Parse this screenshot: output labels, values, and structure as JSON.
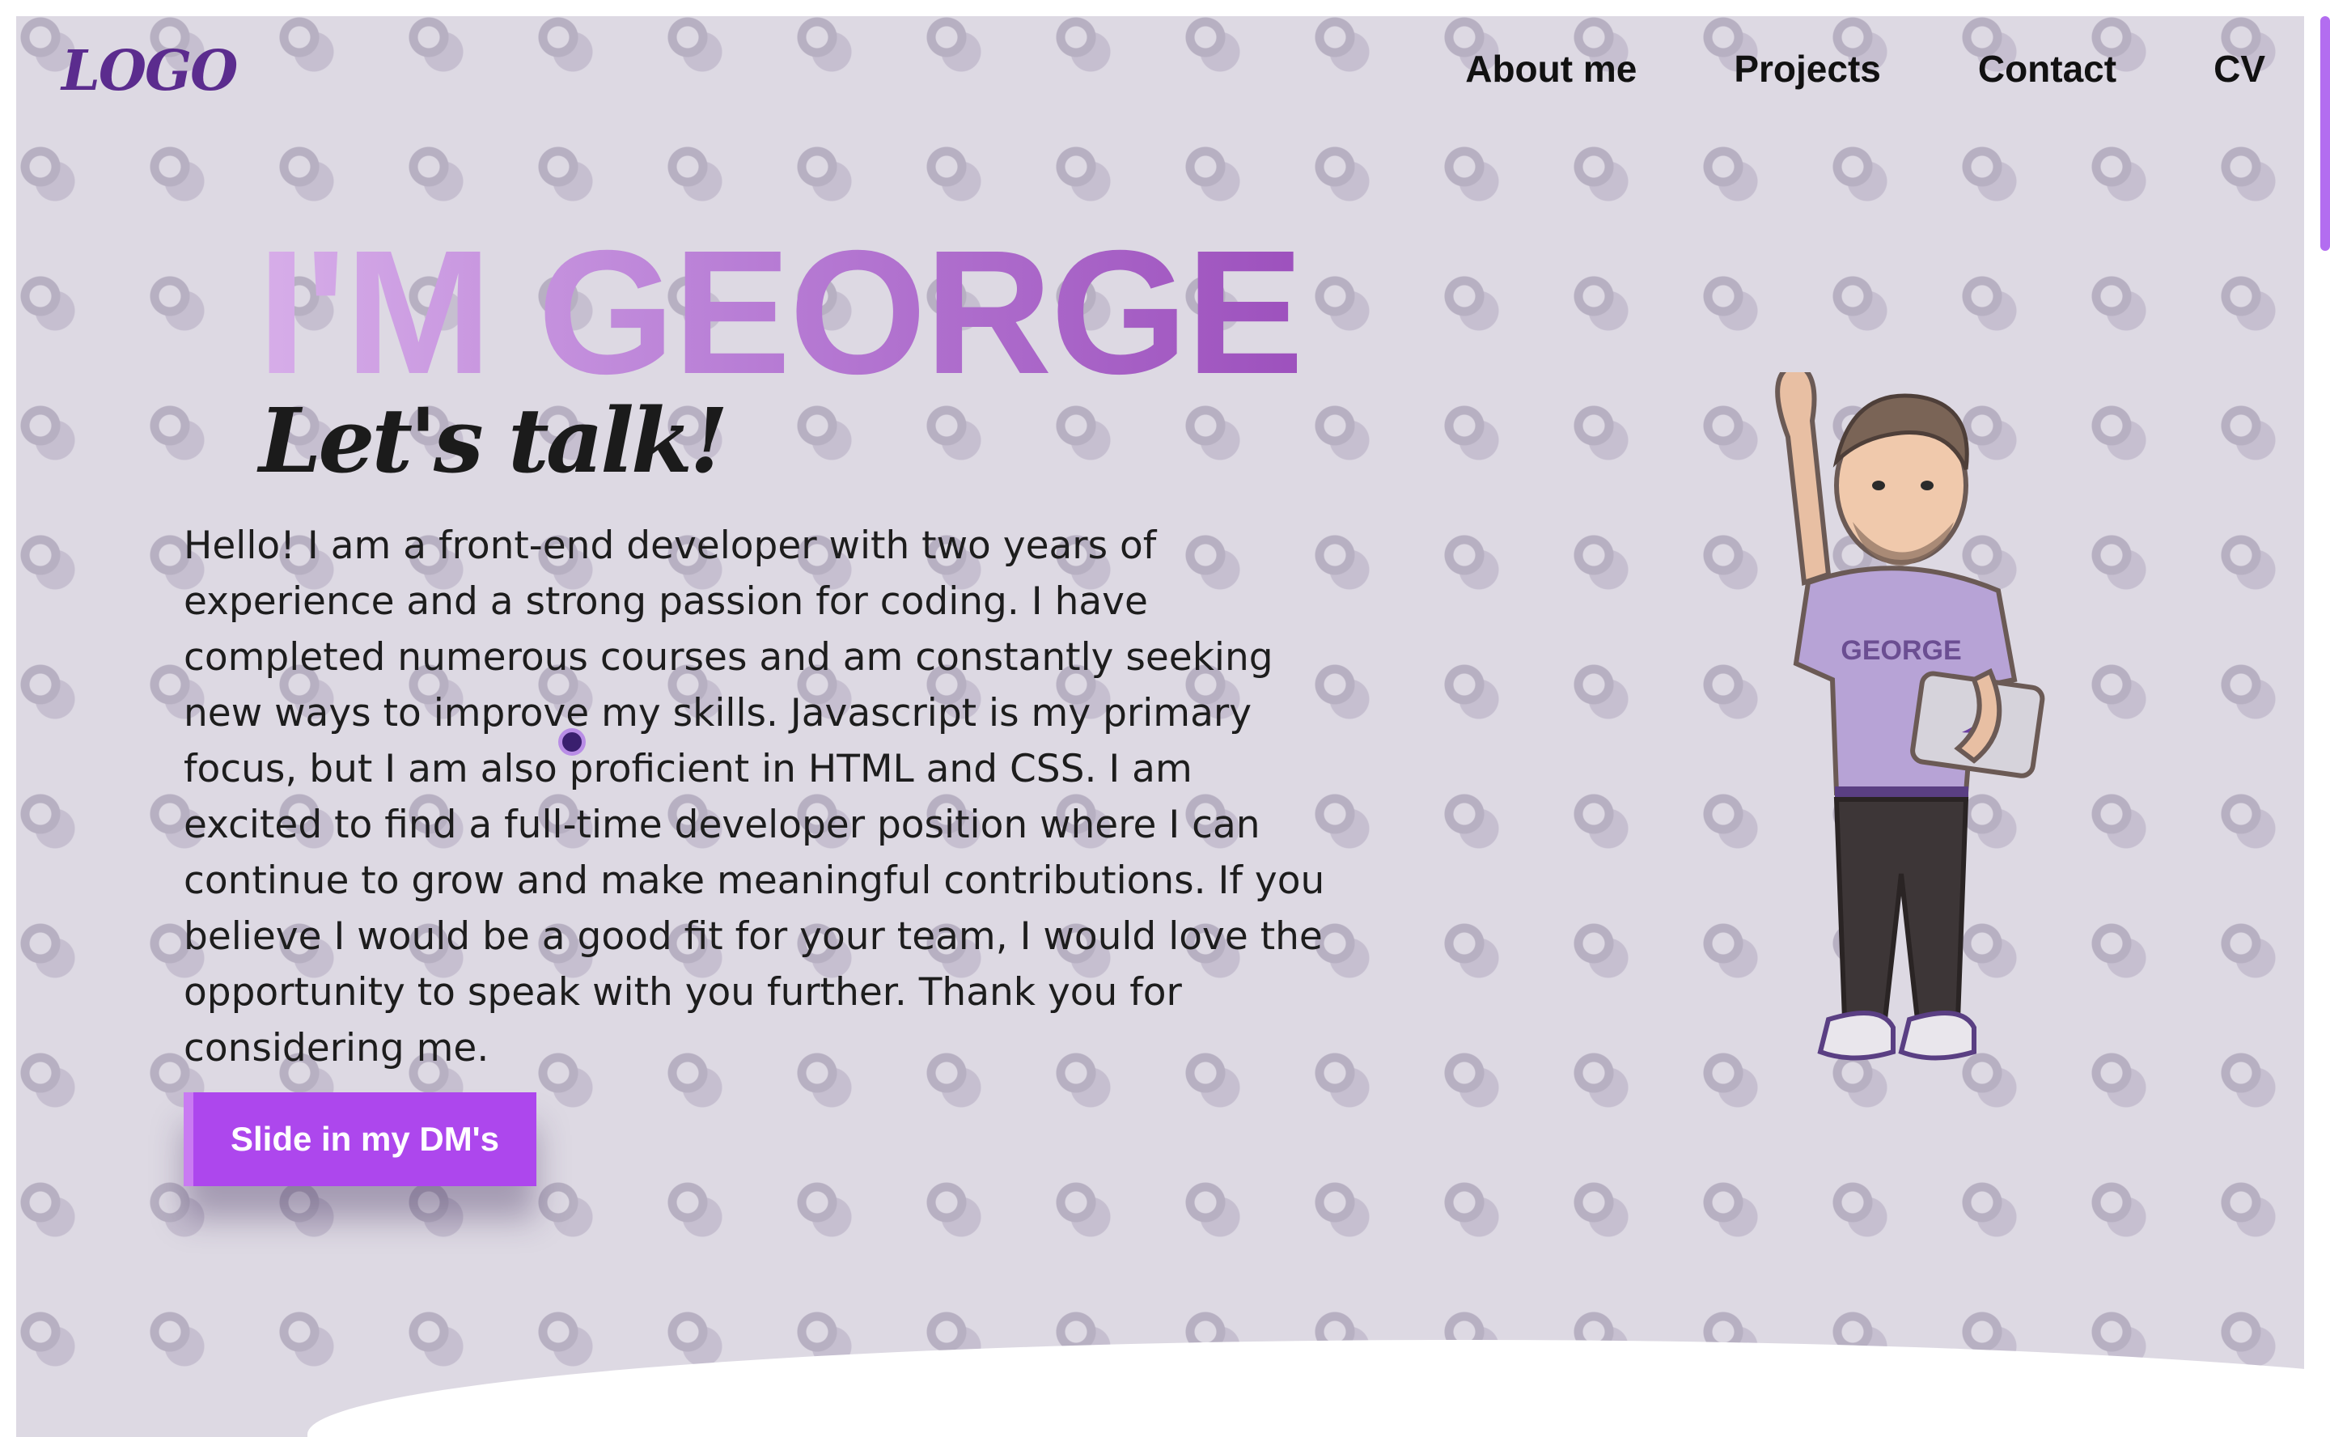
{
  "header": {
    "logo": "LOGO",
    "nav": [
      "About me",
      "Projects",
      "Contact",
      "CV"
    ]
  },
  "hero": {
    "title": "I'M GEORGE",
    "subtitle": "Let's talk!",
    "bio": "Hello! I am a front-end developer with two years of experience and a strong passion for coding. I have completed numerous courses and am constantly seeking new ways to improve my skills. Javascript is my primary focus, but I am also proficient in HTML and CSS. I am excited to find a full-time developer position where I can continue to grow and make meaningful contributions. If you believe I would be a good fit for your team, I would love the opportunity to speak with you further. Thank you for considering me.",
    "cta_label": "Slide in my DM's"
  },
  "avatar": {
    "shirt_text": "GEORGE"
  },
  "colors": {
    "accent": "#ad47ed",
    "background": "#ddd9e3",
    "logo": "#5b2c8e"
  }
}
